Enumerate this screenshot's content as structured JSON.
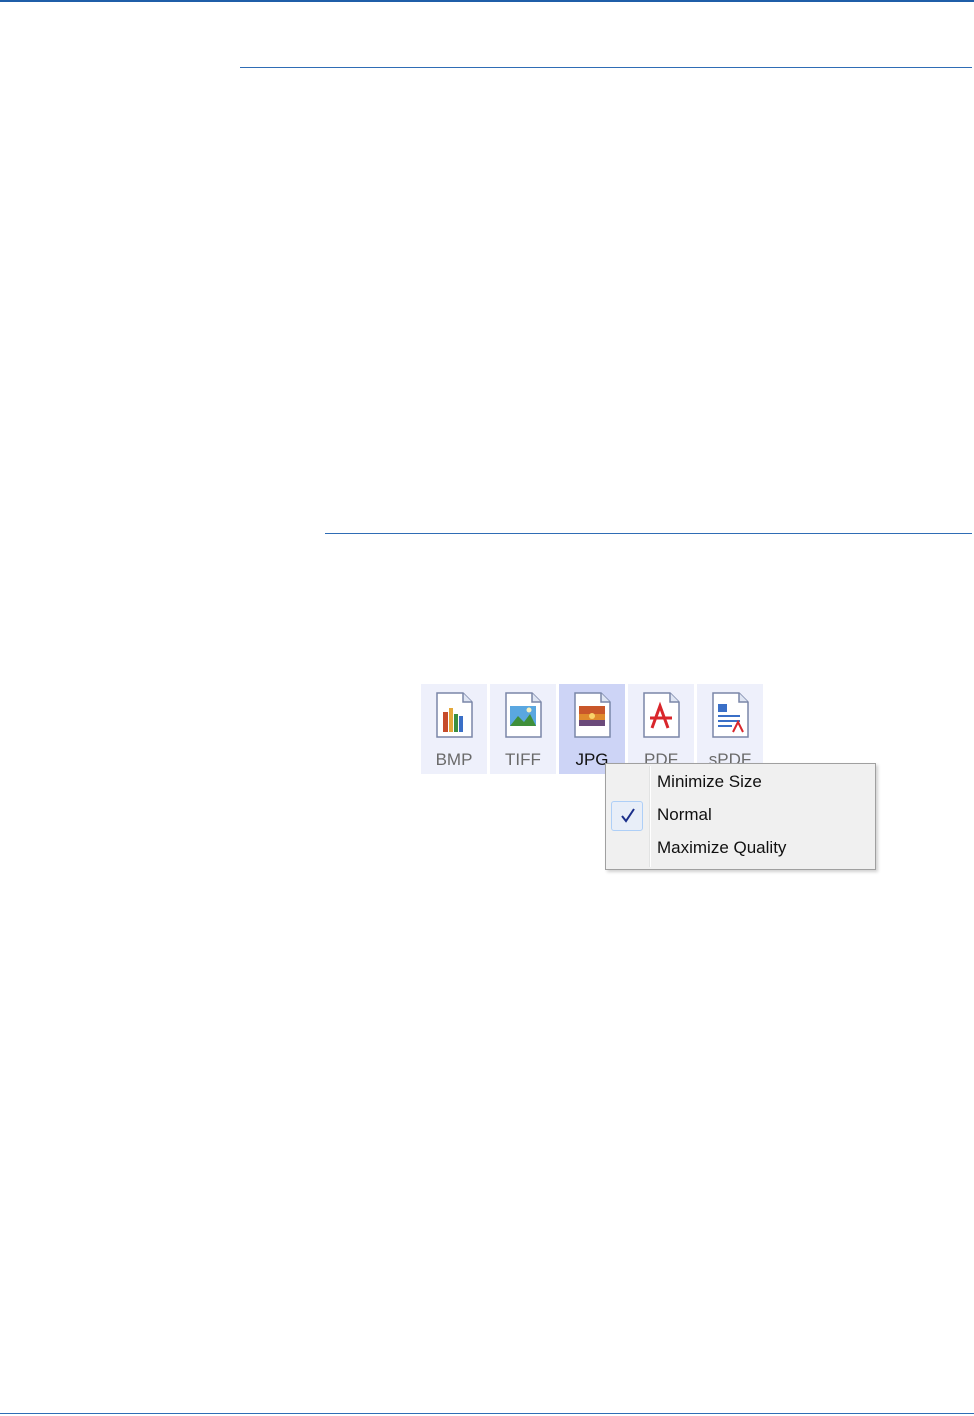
{
  "format_bar": {
    "formats": [
      {
        "label": "BMP",
        "icon": "bmp-file-icon",
        "selected": false
      },
      {
        "label": "TIFF",
        "icon": "tiff-file-icon",
        "selected": false
      },
      {
        "label": "JPG",
        "icon": "jpg-file-icon",
        "selected": true
      },
      {
        "label": "PDF",
        "icon": "pdf-file-icon",
        "selected": false
      },
      {
        "label": "sPDF",
        "icon": "spdf-file-icon",
        "selected": false
      }
    ]
  },
  "context_menu": {
    "items": [
      {
        "label": "Minimize Size",
        "checked": false
      },
      {
        "label": "Normal",
        "checked": true
      },
      {
        "label": "Maximize Quality",
        "checked": false
      }
    ],
    "check_color": "#1a2f8a"
  },
  "colors": {
    "rule": "#2f6db5",
    "selected_tile": "#cdd4f6",
    "tile": "#eef0fb"
  }
}
